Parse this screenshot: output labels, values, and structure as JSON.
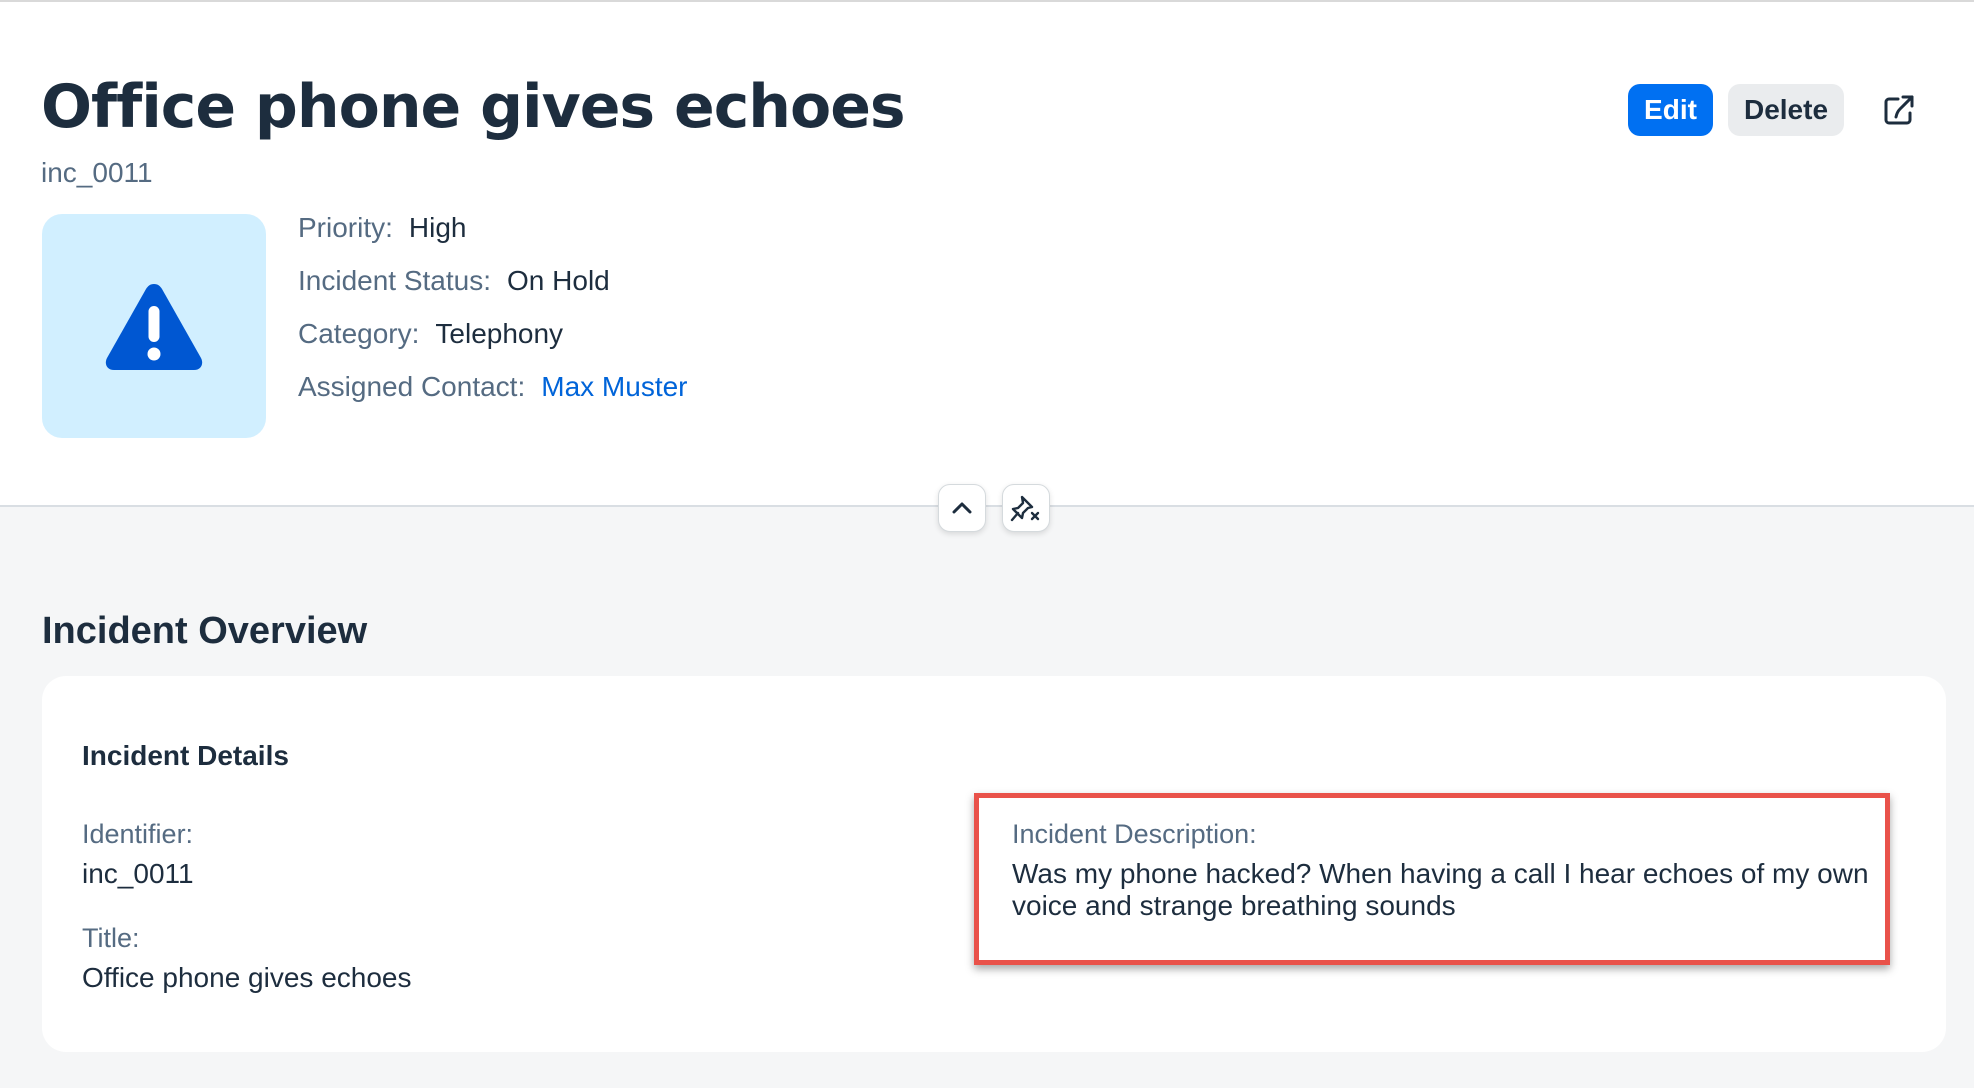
{
  "header": {
    "title": "Office phone gives echoes",
    "subtitle": "inc_0011",
    "actions": {
      "edit_label": "Edit",
      "delete_label": "Delete",
      "share_icon": "share-icon"
    },
    "avatar_icon": "warning-icon",
    "attributes": {
      "priority": {
        "label": "Priority:",
        "value": "High"
      },
      "status": {
        "label": "Incident Status:",
        "value": "On Hold"
      },
      "category": {
        "label": "Category:",
        "value": "Telephony"
      },
      "contact": {
        "label": "Assigned Contact:",
        "value": "Max Muster"
      }
    },
    "toggles": {
      "collapse_icon": "chevron-up-icon",
      "unpin_icon": "unpin-icon"
    }
  },
  "overview": {
    "title": "Incident Overview",
    "card": {
      "title": "Incident Details",
      "identifier": {
        "label": "Identifier:",
        "value": "inc_0011"
      },
      "title_field": {
        "label": "Title:",
        "value": "Office phone gives echoes"
      },
      "description": {
        "label": "Incident Description:",
        "value": "Was my phone hacked? When having a call I hear echoes of my own voice and strange breathing sounds"
      }
    }
  },
  "colors": {
    "accent": "#0070f2",
    "avatar_bg": "#d1efff",
    "warning_icon": "#0057d2",
    "highlight": "#e9524a",
    "link": "#0064d9"
  }
}
